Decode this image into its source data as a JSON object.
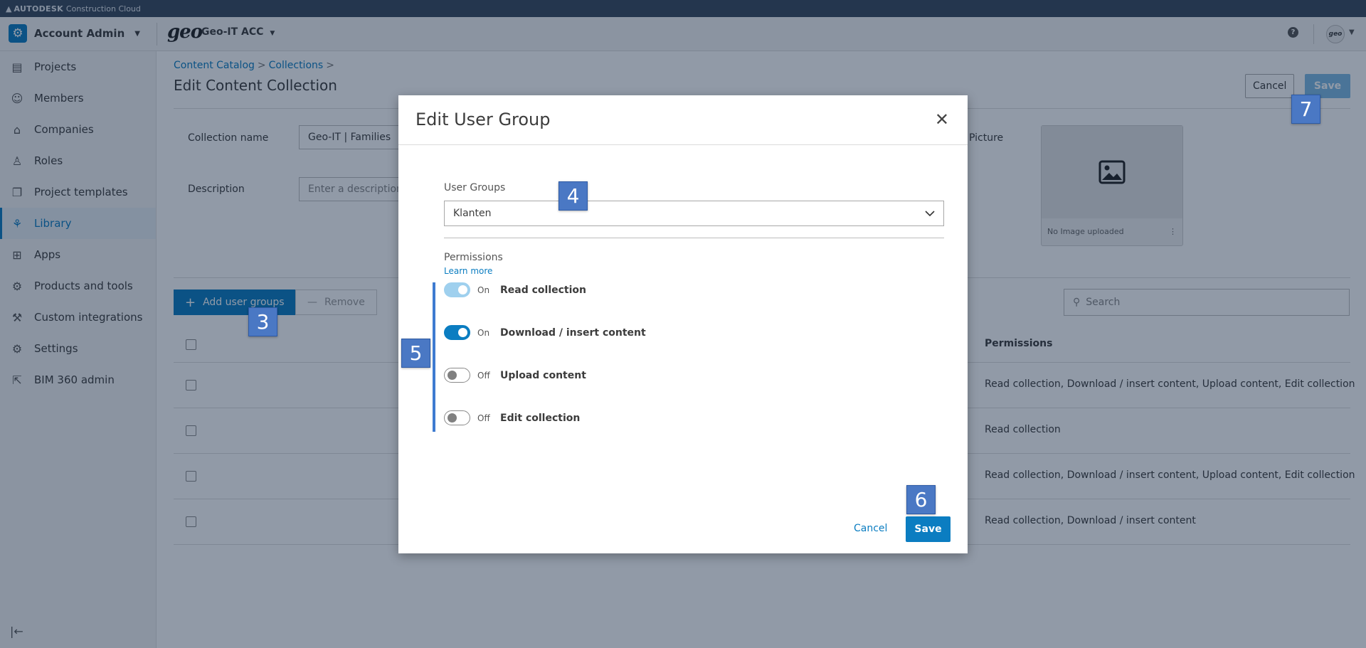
{
  "topbar": {
    "brand": "AUTODESK",
    "product": "Construction Cloud"
  },
  "appbar": {
    "account": "Account Admin",
    "logo_text": "geo",
    "project": "Geo-IT ACC",
    "help": "?",
    "avatar_text": "geo"
  },
  "sidebar": {
    "items": [
      {
        "label": "Projects",
        "icon": "projects-icon",
        "glyph": "▤"
      },
      {
        "label": "Members",
        "icon": "members-icon",
        "glyph": "☺"
      },
      {
        "label": "Companies",
        "icon": "companies-icon",
        "glyph": "⌂"
      },
      {
        "label": "Roles",
        "icon": "roles-icon",
        "glyph": "♙"
      },
      {
        "label": "Project templates",
        "icon": "templates-icon",
        "glyph": "❐"
      },
      {
        "label": "Library",
        "icon": "library-icon",
        "glyph": "⚘"
      },
      {
        "label": "Apps",
        "icon": "apps-icon",
        "glyph": "⊞"
      },
      {
        "label": "Products and tools",
        "icon": "products-icon",
        "glyph": "⚙"
      },
      {
        "label": "Custom integrations",
        "icon": "integrations-icon",
        "glyph": "⚒"
      },
      {
        "label": "Settings",
        "icon": "settings-icon",
        "glyph": "⚙"
      },
      {
        "label": "BIM 360 admin",
        "icon": "external-link-icon",
        "glyph": "⇱"
      }
    ],
    "active_index": 5
  },
  "page": {
    "breadcrumb": [
      "Content Catalog",
      "Collections"
    ],
    "title": "Edit Content Collection",
    "cancel": "Cancel",
    "save": "Save",
    "collection_name_label": "Collection name",
    "collection_name_value": "Geo-IT | Families",
    "description_label": "Description",
    "description_placeholder": "Enter a description",
    "picture_label": "Picture",
    "no_image": "No Image uploaded",
    "add_user_groups": "Add user groups",
    "remove": "Remove",
    "search_placeholder": "Search",
    "permissions_header": "Permissions",
    "rows": [
      "Read collection, Download / insert content, Upload content, Edit collection",
      "Read collection",
      "Read collection, Download / insert content, Upload content, Edit collection",
      "Read collection, Download / insert content"
    ]
  },
  "modal": {
    "title": "Edit User Group",
    "user_groups_label": "User Groups",
    "user_group_selected": "Klanten",
    "permissions_label": "Permissions",
    "learn_more": "Learn more",
    "permissions": [
      {
        "label": "Read collection",
        "state": "On",
        "on": true,
        "disabled": true
      },
      {
        "label": "Download / insert content",
        "state": "On",
        "on": true,
        "disabled": false
      },
      {
        "label": "Upload content",
        "state": "Off",
        "on": false,
        "disabled": false
      },
      {
        "label": "Edit collection",
        "state": "Off",
        "on": false,
        "disabled": false
      }
    ],
    "cancel": "Cancel",
    "save": "Save"
  },
  "markers": [
    "3",
    "4",
    "5",
    "6",
    "7"
  ],
  "colors": {
    "accent": "#0b7dc1",
    "marker": "#4a78c4",
    "topbar": "#3a4a5e"
  }
}
